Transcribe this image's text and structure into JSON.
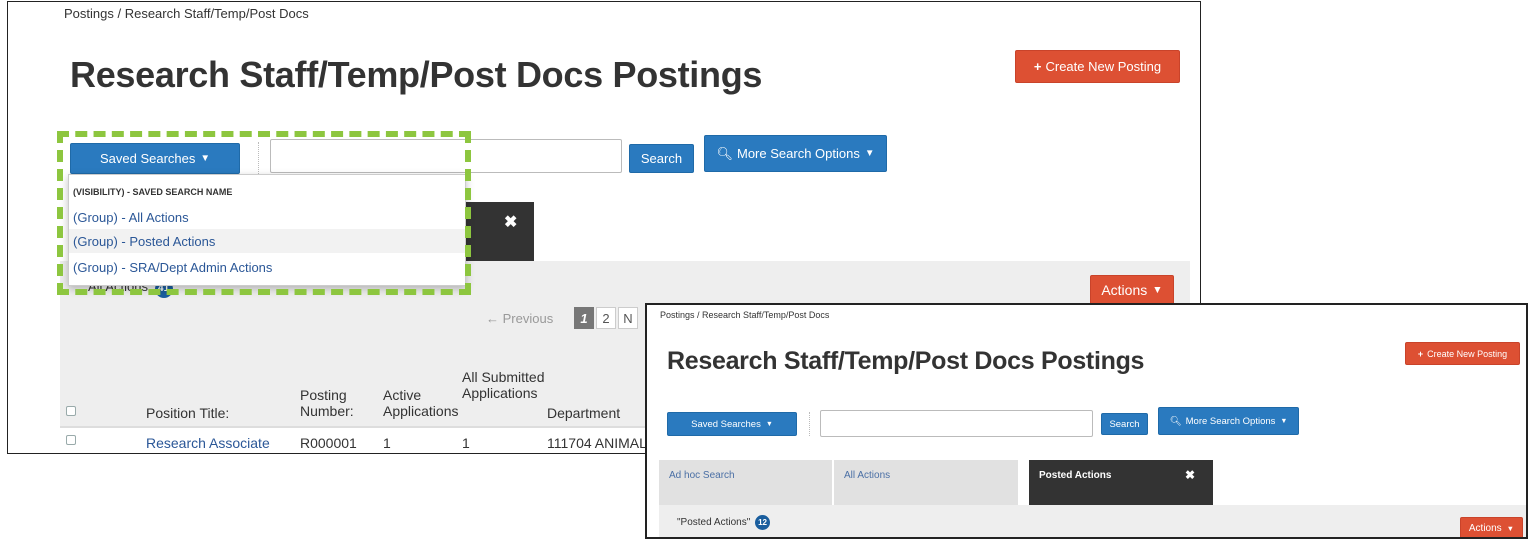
{
  "panel_main": {
    "breadcrumb": "Postings / Research Staff/Temp/Post Docs",
    "page_title": "Research Staff/Temp/Post Docs Postings",
    "create_button": "Create New Posting",
    "saved_searches_button": "Saved Searches",
    "search_input": {
      "value": "",
      "placeholder": ""
    },
    "search_button": "Search",
    "more_search_options_button": "More Search Options",
    "dropdown": {
      "header": "(VISIBILITY) - SAVED SEARCH NAME",
      "items": [
        "(Group) - All Actions",
        "(Group) - Posted Actions",
        "(Group) - SRA/Dept Admin Actions"
      ]
    },
    "tab_close_glyph": "✖",
    "results_label": "All Actions",
    "results_count": "41",
    "actions_button": "Actions",
    "pagination": {
      "previous": "← Previous",
      "pages": [
        "1",
        "2"
      ],
      "next_partial": "N"
    },
    "table": {
      "headers": [
        "Position Title:",
        "Posting Number:",
        "Active Applications",
        "All Submitted Applications",
        "Department"
      ],
      "rows": [
        {
          "position_title": "Research Associate",
          "posting_number": "R000001",
          "active": "1",
          "submitted": "1",
          "department": "111704 ANIMAL"
        }
      ]
    }
  },
  "panel_inset": {
    "breadcrumb": "Postings / Research Staff/Temp/Post Docs",
    "page_title": "Research Staff/Temp/Post Docs Postings",
    "create_button": "Create New Posting",
    "saved_searches_button": "Saved Searches",
    "search_input": {
      "value": "",
      "placeholder": ""
    },
    "search_button": "Search",
    "more_search_options_button": "More Search Options",
    "tabs": [
      {
        "label": "Ad hoc Search",
        "active": false
      },
      {
        "label": "All Actions",
        "active": false
      },
      {
        "label": "Posted Actions",
        "active": true
      }
    ],
    "tab_close_glyph": "✖",
    "results_label": "\"Posted Actions\"",
    "results_count": "12",
    "actions_button": "Actions"
  },
  "icons": {
    "plus": "plus-icon",
    "search": "search-icon",
    "chevron": "chevron-down-icon",
    "close": "close-icon"
  },
  "colors": {
    "primary_blue": "#2a7abf",
    "danger_red": "#dd5033",
    "dark_tab": "#333333",
    "highlight_dashed": "#8dc63f",
    "badge": "#1a5e9e"
  }
}
